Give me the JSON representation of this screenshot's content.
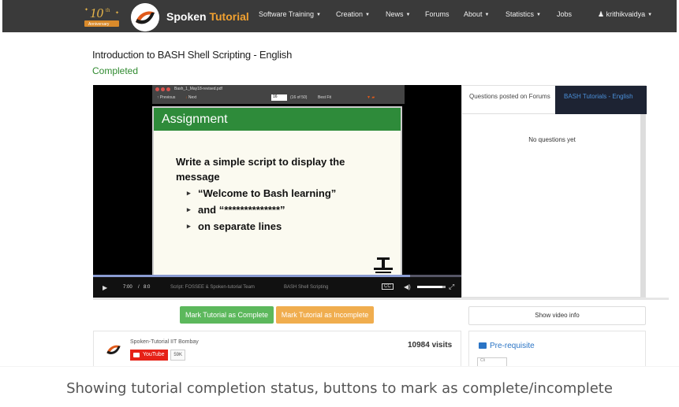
{
  "nav": {
    "badge_text": "10",
    "badge_sup": "th",
    "badge_ribbon": "Anniversary",
    "brand_first": "Spoken",
    "brand_second": "Tutorial",
    "items": [
      {
        "label": "Software Training",
        "has_caret": true
      },
      {
        "label": "Creation",
        "has_caret": true
      },
      {
        "label": "News",
        "has_caret": true
      },
      {
        "label": "Forums",
        "has_caret": false
      },
      {
        "label": "About",
        "has_caret": true
      },
      {
        "label": "Statistics",
        "has_caret": true
      },
      {
        "label": "Jobs",
        "has_caret": false
      }
    ],
    "user": "krithikvaidya",
    "user_icon": "user-icon"
  },
  "tutorial": {
    "title": "Introduction to BASH Shell Scripting - English",
    "status": "Completed"
  },
  "video": {
    "pdf_filename": "Bash_1_May18-revised.pdf",
    "pdf_prev": "Previous",
    "pdf_next": "Next",
    "pdf_page": "16",
    "pdf_page_count": "(16 of 50)",
    "pdf_zoom": "Best Fit",
    "slide_heading": "Assignment",
    "slide_lines": [
      "Write a simple script to display the",
      "message"
    ],
    "slide_bullets": [
      "“Welcome to Bash learning”",
      "and “**************”",
      "on separate lines"
    ],
    "time_current": "7:00",
    "time_separator": "/",
    "time_total": "8:0",
    "subtitle_script": "Script: FOSSEE & Spoken-tutorial Team",
    "subtitle_series": "BASH Shell Scripting",
    "cc_label": "CC",
    "progress": 0.86,
    "volume": 0.9,
    "play_icon": "play-icon",
    "volume_icon": "volume-icon",
    "fullscreen_icon": "fullscreen-icon"
  },
  "questions": {
    "tab_posted": "Questions posted on Forums",
    "tab_series": "BASH Tutorials - English",
    "empty": "No questions yet"
  },
  "actions": {
    "mark_complete": "Mark Tutorial as Complete",
    "mark_incomplete": "Mark Tutorial as Incomplete",
    "show_info": "Show video info"
  },
  "channel": {
    "name": "Spoken-Tutorial IIT Bombay",
    "youtube_label": "YouTube",
    "subscribers": "59K",
    "visits": "10984 visits"
  },
  "prerequisite": {
    "label": "Pre-requisite",
    "thumb_text": "Cli"
  },
  "caption": "Showing tutorial completion status, buttons to mark as complete/incomplete",
  "colors": {
    "navbar": "#3a3a3a",
    "brand_accent": "#f0a030",
    "status": "#2f8a2f",
    "complete_btn": "#5cb85c",
    "incomplete_btn": "#f0ad4e",
    "link": "#2a74c5",
    "slide_header": "#2e8b3a"
  }
}
